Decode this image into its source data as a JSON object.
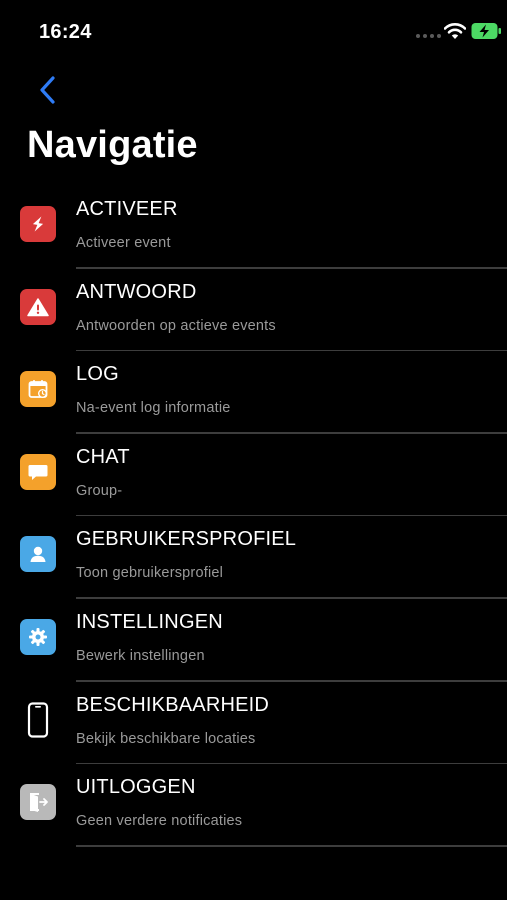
{
  "status_bar": {
    "time": "16:24"
  },
  "nav": {
    "title": "Navigatie"
  },
  "colors": {
    "accent": "#2f7cf6",
    "red": "#d93a3a",
    "orange": "#f4a12b",
    "blue": "#4aa8e6",
    "gray": "#b9b9b9",
    "battery_green": "#4cd964"
  },
  "menu": [
    {
      "title": "ACTIVEER",
      "subtitle": "Activeer event",
      "icon": "bolt-icon"
    },
    {
      "title": "ANTWOORD",
      "subtitle": "Antwoorden op actieve events",
      "icon": "warning-icon"
    },
    {
      "title": "LOG",
      "subtitle": "Na-event log informatie",
      "icon": "calendar-icon"
    },
    {
      "title": "CHAT",
      "subtitle": "Group-",
      "icon": "chat-icon"
    },
    {
      "title": "GEBRUIKERSPROFIEL",
      "subtitle": "Toon gebruikersprofiel",
      "icon": "person-icon"
    },
    {
      "title": "INSTELLINGEN",
      "subtitle": "Bewerk instellingen",
      "icon": "gear-icon"
    },
    {
      "title": "BESCHIKBAARHEID",
      "subtitle": "Bekijk beschikbare locaties",
      "icon": "phone-icon"
    },
    {
      "title": "UITLOGGEN",
      "subtitle": "Geen verdere notificaties",
      "icon": "logout-icon"
    }
  ]
}
